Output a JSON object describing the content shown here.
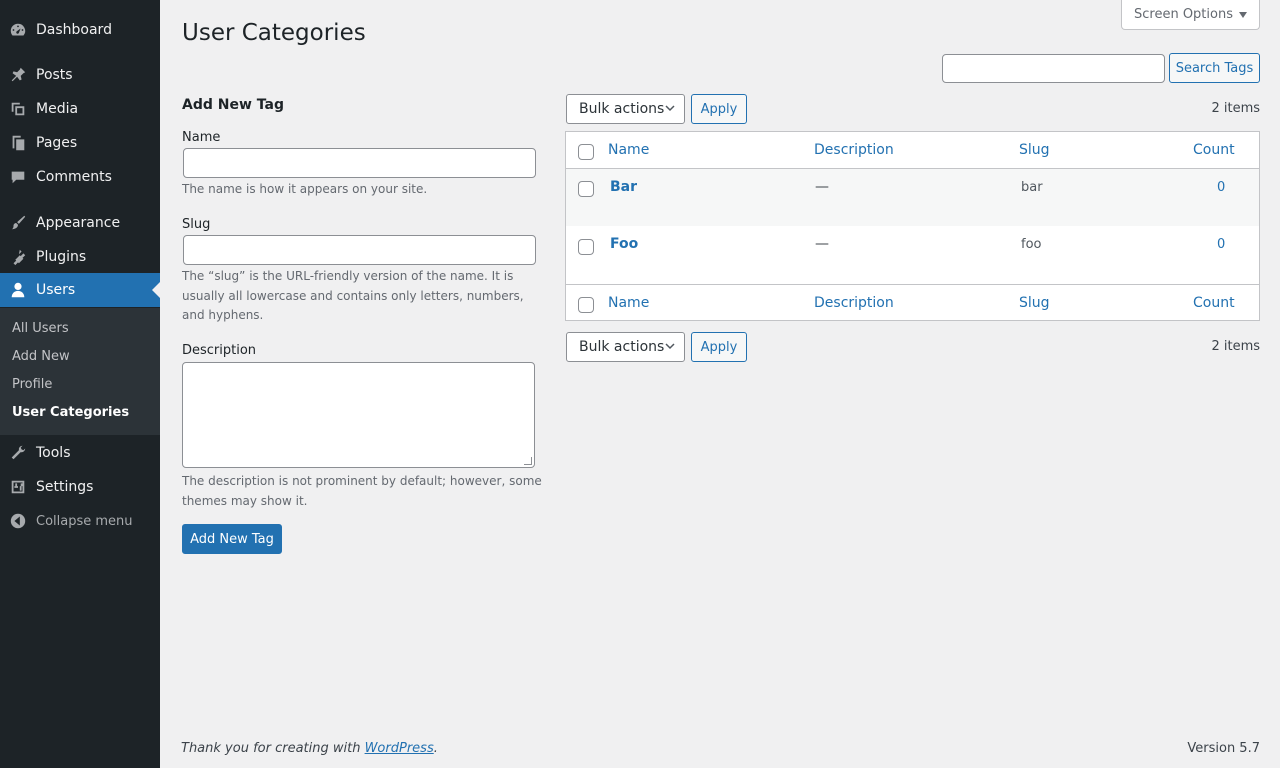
{
  "sidebar": {
    "items": [
      {
        "label": "Dashboard",
        "icon": "dashboard-icon"
      },
      {
        "label": "Posts",
        "icon": "pin-icon"
      },
      {
        "label": "Media",
        "icon": "media-icon"
      },
      {
        "label": "Pages",
        "icon": "pages-icon"
      },
      {
        "label": "Comments",
        "icon": "comment-icon"
      },
      {
        "label": "Appearance",
        "icon": "paintbrush-icon"
      },
      {
        "label": "Plugins",
        "icon": "plugin-icon"
      },
      {
        "label": "Users",
        "icon": "user-icon"
      },
      {
        "label": "Tools",
        "icon": "wrench-icon"
      },
      {
        "label": "Settings",
        "icon": "settings-icon"
      }
    ],
    "submenu": [
      "All Users",
      "Add New",
      "Profile",
      "User Categories"
    ],
    "collapse_label": "Collapse menu"
  },
  "header": {
    "title": "User Categories",
    "screen_options": "Screen Options",
    "search_button": "Search Tags",
    "search_value": ""
  },
  "form": {
    "heading": "Add New Tag",
    "name_label": "Name",
    "name_value": "",
    "name_help": "The name is how it appears on your site.",
    "slug_label": "Slug",
    "slug_value": "",
    "slug_help": "The “slug” is the URL-friendly version of the name. It is usually all lowercase and contains only letters, numbers, and hyphens.",
    "description_label": "Description",
    "description_value": "",
    "description_help": "The description is not prominent by default; however, some themes may show it.",
    "submit_label": "Add New Tag"
  },
  "table": {
    "bulk_actions": "Bulk actions",
    "apply_label": "Apply",
    "items_count": "2 items",
    "columns": {
      "name": "Name",
      "description": "Description",
      "slug": "Slug",
      "count": "Count"
    },
    "rows": [
      {
        "name": "Bar",
        "description": "—",
        "slug": "bar",
        "count": "0"
      },
      {
        "name": "Foo",
        "description": "—",
        "slug": "foo",
        "count": "0"
      }
    ]
  },
  "footer": {
    "thanks_prefix": "Thank you for creating with ",
    "thanks_link": "WordPress",
    "thanks_suffix": ".",
    "version": "Version 5.7"
  },
  "colors": {
    "accent": "#2271b1",
    "sidebar": "#1d2327",
    "submenu": "#2c3338"
  }
}
